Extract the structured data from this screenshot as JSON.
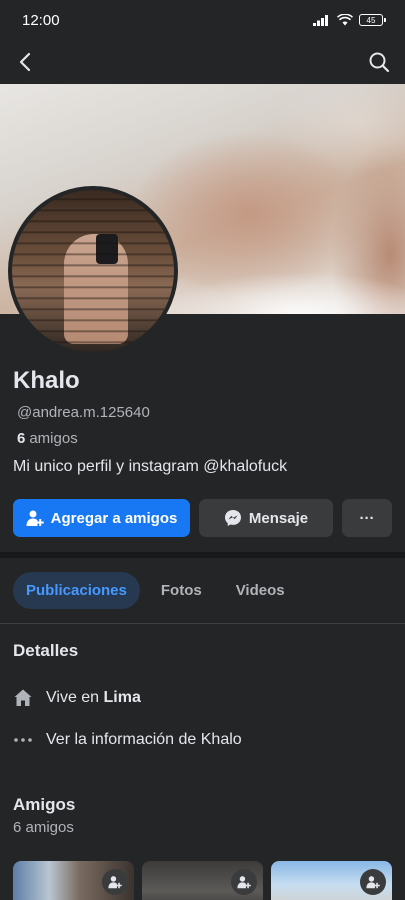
{
  "status_bar": {
    "time": "12:00",
    "battery": "45"
  },
  "nav": {
    "back_icon": "chevron-left-icon",
    "search_icon": "search-icon"
  },
  "profile": {
    "name": "Khalo",
    "username": "@andrea.m.125640",
    "friends_count": "6",
    "friends_label": "amigos",
    "bio": "Mi unico perfil y instagram @khalofuck"
  },
  "actions": {
    "add_friend": "Agregar a amigos",
    "message": "Mensaje",
    "more": "···"
  },
  "tabs": [
    {
      "label": "Publicaciones",
      "active": true
    },
    {
      "label": "Fotos",
      "active": false
    },
    {
      "label": "Videos",
      "active": false
    }
  ],
  "details": {
    "title": "Detalles",
    "lives_prefix": "Vive en",
    "lives_city": "Lima",
    "see_info": "Ver la información de Khalo"
  },
  "friends_section": {
    "title": "Amigos",
    "count_label": "6 amigos"
  },
  "colors": {
    "accent": "#1877f2",
    "background": "#242526",
    "active_tab_bg": "#263951",
    "active_tab_text": "#4599ff"
  }
}
